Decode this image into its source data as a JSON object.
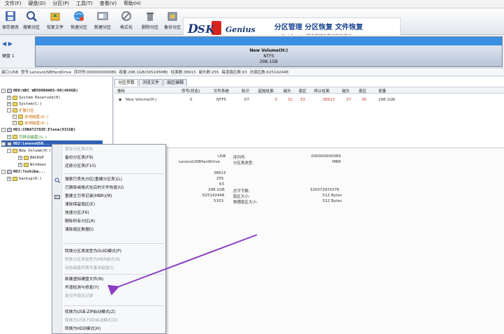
{
  "menubar": {
    "items": [
      "文件(F)",
      "硬盘(D)",
      "分区(P)",
      "工具(T)",
      "查看(V)",
      "帮助(H)"
    ]
  },
  "toolbar": {
    "buttons": [
      "保存更改",
      "搜索分区",
      "恢复文件",
      "快速分区",
      "新建分区",
      "格式化",
      "删除分区",
      "备份分区"
    ]
  },
  "banner": {
    "logo_prefix": "D",
    "logo_mid": "SK",
    "logo_suffix": "Genius",
    "slogan": "分区管理 分区恢复 文件恢复",
    "subtitle": "DiskGenius 磁盘管理及数据恢复软件"
  },
  "diskbar": {
    "label": "硬盘 1",
    "partition_name": "New Volume(H:)",
    "partition_fs": "NTFS",
    "partition_size": "298.1GB"
  },
  "infobar": [
    "接口:USB",
    "型号:LenovoUSBHardDrive",
    "序列号:000000000089",
    "容量:298.1GB(305245MB)",
    "柱面数:38913",
    "磁头数:255",
    "每道扇区数:63",
    "总扇区数:625142448"
  ],
  "tree": {
    "rows": [
      "HD0:WDC WD5000AAKS-00(466GB)",
      "System Reserved(0)",
      "System(C:)",
      "扩展分区",
      "本地磁盘(D:)",
      "本地磁盘(E:)",
      "HD1:CHBAT2T0ZE:Elena(931GB)",
      "可移动磁盘(G:)",
      "HD2:LenovoUSB...",
      "New Volume(H:)",
      "BACKUP",
      "Windows",
      "RD3:Toshiba...",
      "backup(K:)"
    ]
  },
  "tabs": [
    "分区参数",
    "浏览文件",
    "扇区编辑"
  ],
  "grid": {
    "headers": [
      "卷标",
      "序号(状态)",
      "文件系统",
      "标识",
      "起始柱面",
      "磁头",
      "扇区",
      "终止柱面",
      "磁头",
      "扇区",
      "容量"
    ],
    "row": [
      "New Volume(H:)",
      "0",
      "NTFS",
      "07",
      "0",
      "32",
      "33",
      "38913",
      "37",
      "36",
      "298.1GB"
    ]
  },
  "details": {
    "left_values": [
      "USB",
      "LenovoUSBHardDrive",
      "38913",
      "255",
      "63",
      "298.1GB",
      "625142448",
      "5103"
    ],
    "labels": [
      "序列号:",
      "分区表类型:",
      "总字节数:",
      "扇区大小:",
      "物理扇区大小:"
    ],
    "right_values": [
      "000000000089",
      "MBR",
      "320072933376",
      "512 Bytes",
      "512 Bytes"
    ]
  },
  "context_menu": {
    "items": [
      {
        "label": "保存分区表(F8)",
        "disabled": true
      },
      {
        "label": "备份分区表(F9)",
        "disabled": false
      },
      {
        "label": "还原分区表(F10)",
        "disabled": false
      },
      {
        "label": "搜索已丢失分区(重建分区表)(L)",
        "disabled": false
      },
      {
        "label": "已删除或格式化后的文件恢复(U)",
        "disabled": false
      },
      {
        "label": "重建主引导记录(MBR)(M)",
        "disabled": false
      },
      {
        "label": "清除保留扇区(E)",
        "disabled": false
      },
      {
        "label": "快速分区(F6)",
        "disabled": false
      },
      {
        "label": "删除所有分区(A)",
        "disabled": false
      },
      {
        "label": "清除扇区数据(I)",
        "disabled": false
      },
      {
        "label": "转换分区表类型为GUID模式(P)",
        "disabled": false
      },
      {
        "label": "转换分区表类型为MBR格式(B)",
        "disabled": true
      },
      {
        "label": "动态磁盘转换为基本磁盘(I)",
        "disabled": true
      },
      {
        "label": "新建虚拟硬盘文件(N)",
        "disabled": false
      },
      {
        "label": "坏道检测与修复(Y)",
        "disabled": false
      },
      {
        "label": "复位坏扇区记录",
        "disabled": true
      },
      {
        "label": "转换为USB-ZIP启动模式(Z)",
        "disabled": false
      },
      {
        "label": "转换为USB-FDD启动模式(D)",
        "disabled": true
      },
      {
        "label": "转换为HDD模式(H)",
        "disabled": false
      }
    ]
  },
  "colors": {
    "accent": "#2f5fb8",
    "partition": "#3a8fe3",
    "arrow": "#8a3fc4"
  }
}
